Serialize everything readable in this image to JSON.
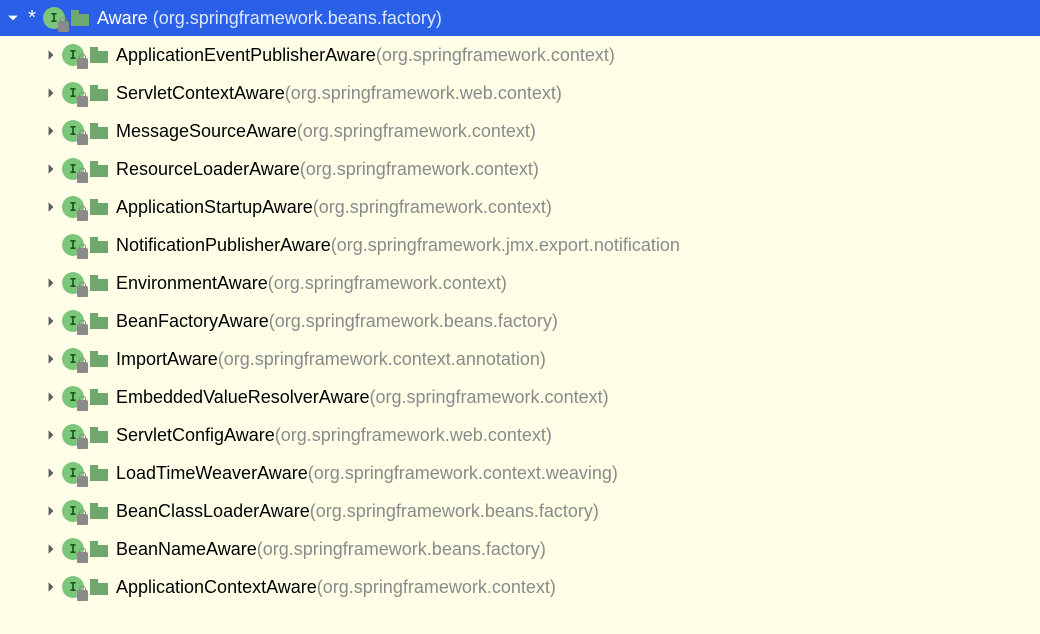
{
  "root": {
    "name": "Aware",
    "package": "(org.springframework.beans.factory)",
    "expanded": true,
    "starred": true
  },
  "children": [
    {
      "name": "ApplicationEventPublisherAware",
      "package": "(org.springframework.context)",
      "hasChildren": true
    },
    {
      "name": "ServletContextAware",
      "package": "(org.springframework.web.context)",
      "hasChildren": true
    },
    {
      "name": "MessageSourceAware",
      "package": "(org.springframework.context)",
      "hasChildren": true
    },
    {
      "name": "ResourceLoaderAware",
      "package": "(org.springframework.context)",
      "hasChildren": true
    },
    {
      "name": "ApplicationStartupAware",
      "package": "(org.springframework.context)",
      "hasChildren": true
    },
    {
      "name": "NotificationPublisherAware",
      "package": "(org.springframework.jmx.export.notification",
      "hasChildren": false
    },
    {
      "name": "EnvironmentAware",
      "package": "(org.springframework.context)",
      "hasChildren": true
    },
    {
      "name": "BeanFactoryAware",
      "package": "(org.springframework.beans.factory)",
      "hasChildren": true
    },
    {
      "name": "ImportAware",
      "package": "(org.springframework.context.annotation)",
      "hasChildren": true
    },
    {
      "name": "EmbeddedValueResolverAware",
      "package": "(org.springframework.context)",
      "hasChildren": true
    },
    {
      "name": "ServletConfigAware",
      "package": "(org.springframework.web.context)",
      "hasChildren": true
    },
    {
      "name": "LoadTimeWeaverAware",
      "package": "(org.springframework.context.weaving)",
      "hasChildren": true
    },
    {
      "name": "BeanClassLoaderAware",
      "package": "(org.springframework.beans.factory)",
      "hasChildren": true
    },
    {
      "name": "BeanNameAware",
      "package": "(org.springframework.beans.factory)",
      "hasChildren": true
    },
    {
      "name": "ApplicationContextAware",
      "package": "(org.springframework.context)",
      "hasChildren": true
    }
  ]
}
